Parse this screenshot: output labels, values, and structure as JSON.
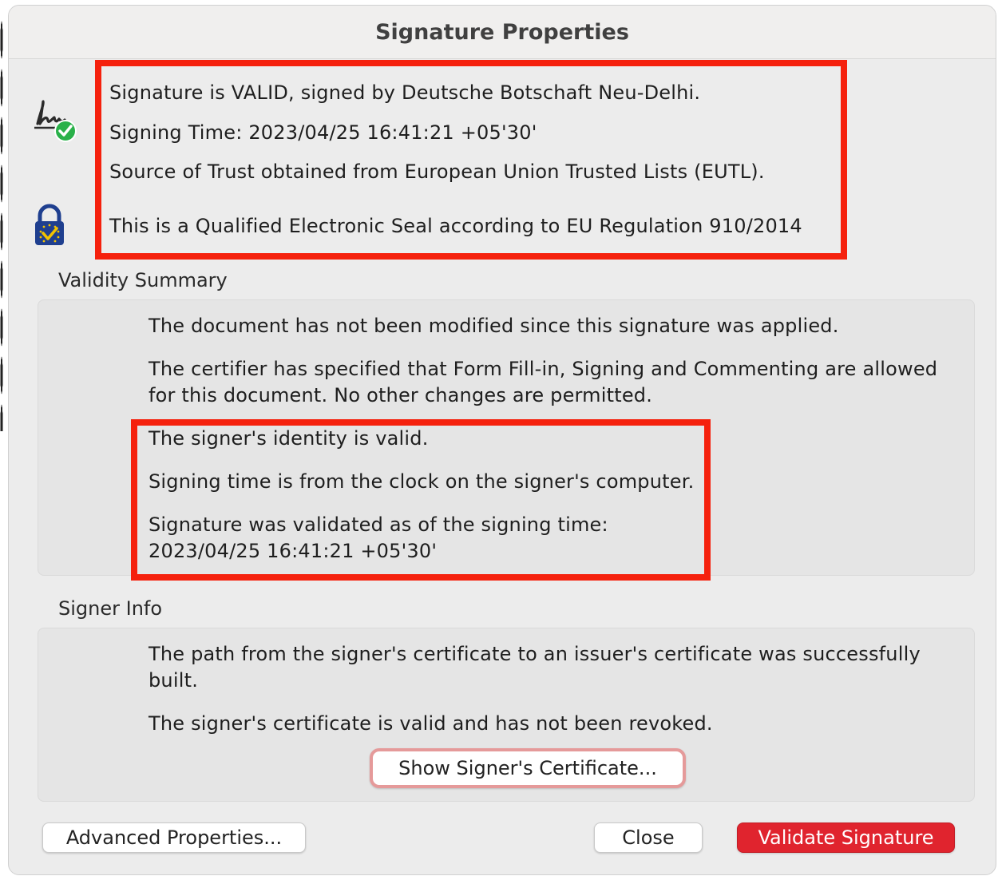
{
  "window": {
    "title": "Signature Properties"
  },
  "status": {
    "line1": "Signature is VALID, signed by Deutsche Botschaft Neu-Delhi.",
    "line2": "Signing Time:  2023/04/25 16:41:21 +05'30'",
    "line3": "Source of Trust obtained from European Union Trusted Lists (EUTL).",
    "line4": "This is a Qualified Electronic Seal according to EU Regulation 910/2014"
  },
  "icons": {
    "signature": "signature-valid-icon",
    "seal": "eu-qualified-seal-lock-icon"
  },
  "validity": {
    "label": "Validity Summary",
    "lines": [
      "The document has not been modified since this signature was applied.",
      "The certifier has specified that Form Fill-in, Signing and Commenting are allowed for this document. No other changes are permitted.",
      "The signer's identity is valid.",
      "Signing time is from the clock on the signer's computer.",
      "Signature was validated as of the signing time:",
      "2023/04/25 16:41:21 +05'30'"
    ]
  },
  "signer": {
    "label": "Signer Info",
    "lines": [
      "The path from the signer's certificate to an issuer's certificate was successfully built.",
      "The signer's certificate is valid and has not been revoked."
    ],
    "cert_button": "Show Signer's Certificate..."
  },
  "buttons": {
    "advanced": "Advanced Properties...",
    "close": "Close",
    "validate": "Validate Signature"
  },
  "colors": {
    "highlight": "#f5210d",
    "primary_button": "#e0242e",
    "check_green": "#2ab14a",
    "lock_blue": "#1f3f8f",
    "check_yellow": "#f3c300"
  }
}
